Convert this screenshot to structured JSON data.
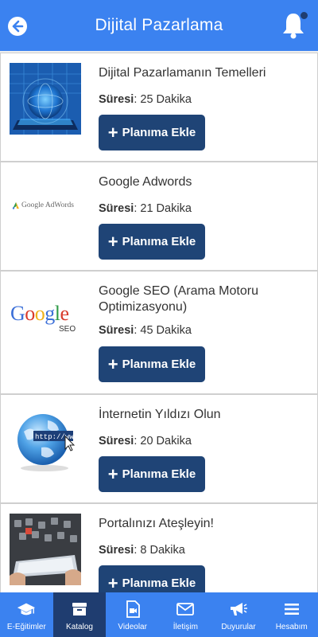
{
  "header": {
    "title": "Dijital Pazarlama"
  },
  "courses": [
    {
      "title": "Dijital Pazarlamanın Temelleri",
      "duration_label": "Süresi",
      "duration_value": ": 25 Dakika",
      "button_label": "Planıma Ekle",
      "thumb_icon": "digital-globe-tablet-image"
    },
    {
      "title": "Google Adwords",
      "duration_label": "Süresi",
      "duration_value": ": 21 Dakika",
      "button_label": "Planıma Ekle",
      "thumb_icon": "google-adwords-logo",
      "thumb_text": "Google AdWords"
    },
    {
      "title": "Google SEO (Arama Motoru Optimizasyonu)",
      "duration_label": "Süresi",
      "duration_value": ": 45 Dakika",
      "button_label": "Planıma Ekle",
      "thumb_icon": "google-seo-logo",
      "thumb_text": "Google",
      "thumb_subtext": "SEO"
    },
    {
      "title": "İnternetin Yıldızı Olun",
      "duration_label": "Süresi",
      "duration_value": ": 20 Dakika",
      "button_label": "Planıma Ekle",
      "thumb_icon": "globe-http-cursor-image",
      "thumb_text": "http://www"
    },
    {
      "title": "Portalınızı Ateşleyin!",
      "duration_label": "Süresi",
      "duration_value": ": 8 Dakika",
      "button_label": "Planıma Ekle",
      "thumb_icon": "hands-tablet-apps-image"
    }
  ],
  "nav": [
    {
      "label": "E-Eğitimler",
      "icon": "graduation-cap-icon",
      "active": false
    },
    {
      "label": "Katalog",
      "icon": "archive-box-icon",
      "active": true
    },
    {
      "label": "Videolar",
      "icon": "video-file-icon",
      "active": false
    },
    {
      "label": "İletişim",
      "icon": "envelope-icon",
      "active": false
    },
    {
      "label": "Duyurular",
      "icon": "megaphone-icon",
      "active": false
    },
    {
      "label": "Hesabım",
      "icon": "menu-icon",
      "active": false
    }
  ],
  "colors": {
    "header": "#3b82f0",
    "button": "#1f4476",
    "nav_active": "#1f3d70"
  }
}
